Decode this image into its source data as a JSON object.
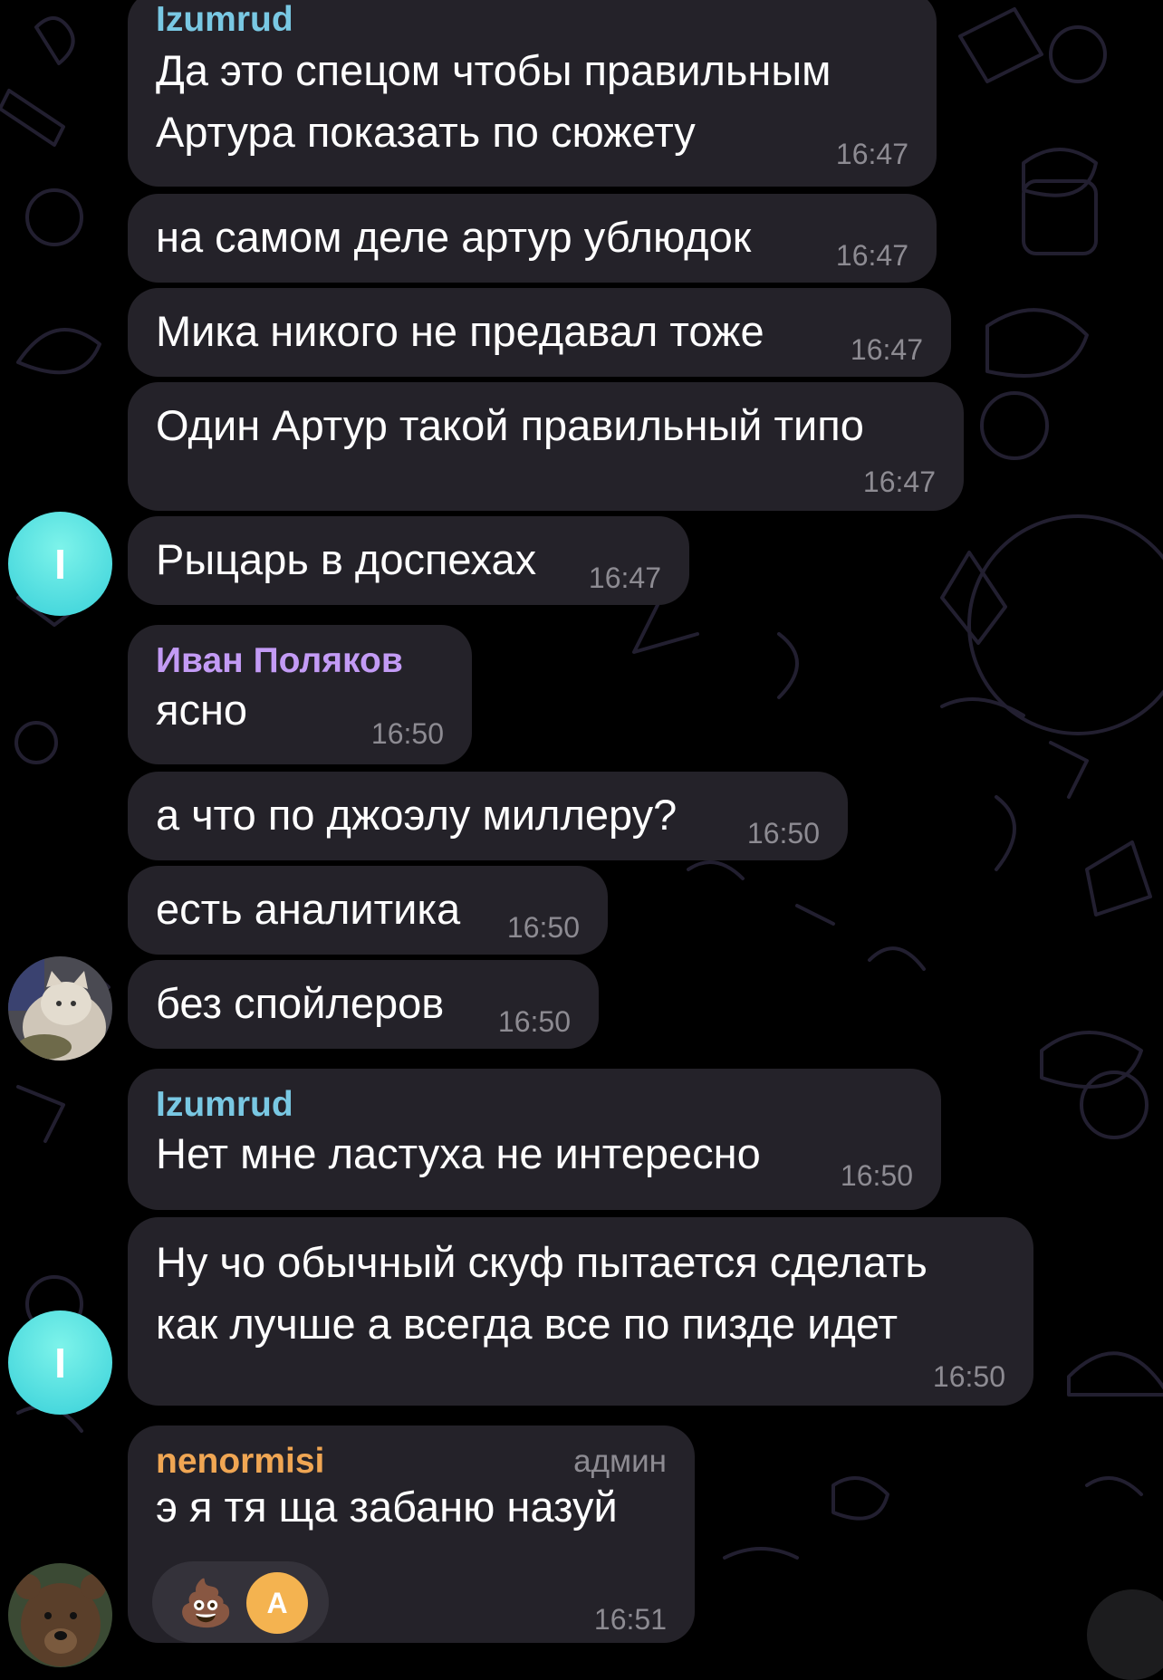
{
  "colors": {
    "background": "#000000",
    "bubble": "#242229",
    "time": "#8d8b92",
    "name_izumrud": "#79c8e3",
    "name_ivan": "#c39bf5",
    "name_admin": "#f0a653",
    "avatar_letter_bg": "#4ddbe0"
  },
  "messages": [
    {
      "sender": "Izumrud",
      "lines": [
        "Да это спецом чтобы правильным",
        "Артура показать по сюжету"
      ],
      "time": "16:47"
    },
    {
      "lines": [
        "на самом деле артур ублюдок"
      ],
      "time": "16:47"
    },
    {
      "lines": [
        "Мика никого не предавал тоже"
      ],
      "time": "16:47"
    },
    {
      "lines": [
        "Один Артур такой правильный типо"
      ],
      "time": "16:47"
    },
    {
      "lines": [
        "Рыцарь в доспехах"
      ],
      "time": "16:47",
      "avatar_letter": "I"
    },
    {
      "sender": "Иван Поляков",
      "lines": [
        "ясно"
      ],
      "time": "16:50"
    },
    {
      "lines": [
        "а что по джоэлу миллеру?"
      ],
      "time": "16:50"
    },
    {
      "lines": [
        "есть аналитика"
      ],
      "time": "16:50"
    },
    {
      "lines": [
        "без спойлеров"
      ],
      "time": "16:50",
      "avatar_icon": "cat-photo"
    },
    {
      "sender": "Izumrud",
      "lines": [
        "Нет мне ластуха не интересно"
      ],
      "time": "16:50"
    },
    {
      "lines": [
        "Ну чо обычный скуф пытается сделать",
        "как лучше а всегда все по пизде идет"
      ],
      "time": "16:50",
      "avatar_letter": "I"
    },
    {
      "sender": "nenormisi",
      "badge": "админ",
      "lines": [
        "э я тя ща забаню  назуй"
      ],
      "time": "16:51",
      "avatar_icon": "bear-photo",
      "reaction": {
        "emoji": "💩",
        "reactor_letter": "A"
      }
    }
  ]
}
